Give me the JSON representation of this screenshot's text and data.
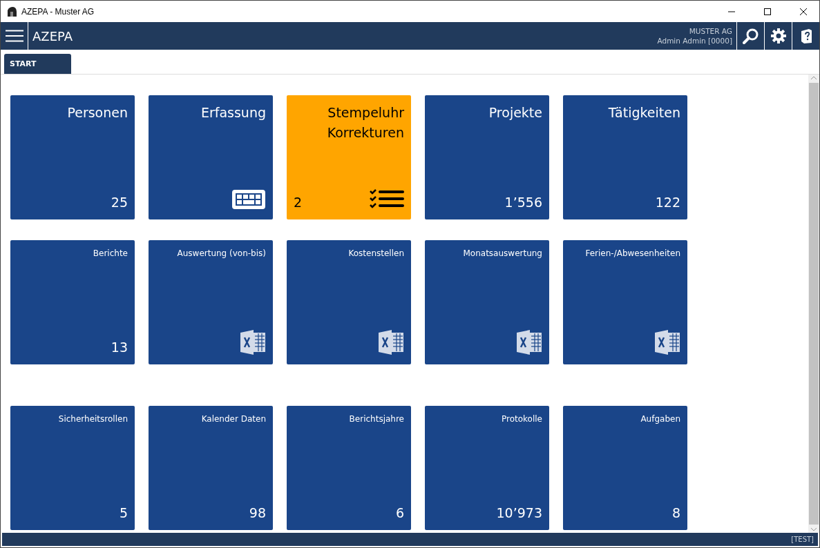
{
  "window": {
    "title": "AZEPA - Muster AG"
  },
  "header": {
    "app_name": "AZEPA",
    "company": "MUSTER AG",
    "user": "Admin Admin [0000]"
  },
  "tabs": [
    {
      "label": "START",
      "selected": true
    }
  ],
  "sections": [
    {
      "rows": [
        {
          "kind": "large",
          "tiles": [
            {
              "title": "Personen",
              "kind": "count",
              "count": "25",
              "color": "#1a4589"
            },
            {
              "title": "Erfassung",
              "kind": "keyboard",
              "color": "#1a4589"
            },
            {
              "title": "Stempeluhr Korrekturen",
              "kind": "checklist",
              "count": "2",
              "color": "#ffa500"
            },
            {
              "title": "Projekte",
              "kind": "count",
              "count": "1’556",
              "color": "#1a4589"
            },
            {
              "title": "Tätigkeiten",
              "kind": "count",
              "count": "122",
              "color": "#1a4589"
            }
          ]
        },
        {
          "kind": "small",
          "tiles": [
            {
              "title": "Berichte",
              "kind": "count",
              "count": "13",
              "color": "#1a4589"
            },
            {
              "title": "Auswertung (von-bis)",
              "kind": "spreadsheet",
              "color": "#1a4589"
            },
            {
              "title": "Kostenstellen",
              "kind": "spreadsheet",
              "color": "#1a4589"
            },
            {
              "title": "Monatsauswertung",
              "kind": "spreadsheet",
              "color": "#1a4589"
            },
            {
              "title": "Ferien-/Abwesenheiten",
              "kind": "spreadsheet",
              "color": "#1a4589"
            }
          ]
        }
      ]
    },
    {
      "rows": [
        {
          "kind": "small",
          "tiles": [
            {
              "title": "Sicherheitsrollen",
              "kind": "count",
              "count": "5",
              "color": "#1a4589"
            },
            {
              "title": "Kalender Daten",
              "kind": "count",
              "count": "98",
              "color": "#1a4589"
            },
            {
              "title": "Berichtsjahre",
              "kind": "count",
              "count": "6",
              "color": "#1a4589"
            },
            {
              "title": "Protokolle",
              "kind": "count",
              "count": "10’973",
              "color": "#1a4589"
            },
            {
              "title": "Aufgaben",
              "kind": "count",
              "count": "8",
              "color": "#1a4589"
            }
          ]
        }
      ]
    }
  ],
  "status_bar": {
    "text": "[TEST]"
  }
}
